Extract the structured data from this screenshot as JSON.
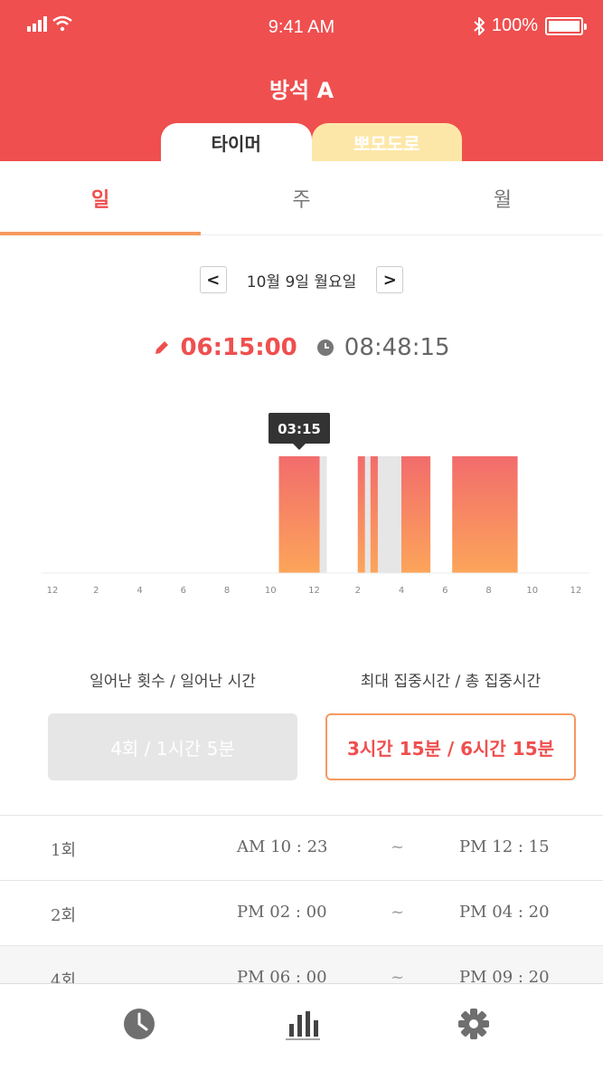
{
  "status_bar": {
    "time": "9:41 AM",
    "battery": "100%"
  },
  "app_title": "방석 A",
  "mode_tabs": {
    "timer": "타이머",
    "pomodoro": "뽀모도로"
  },
  "period_tabs": [
    "일",
    "주",
    "월"
  ],
  "date_nav": {
    "date": "10월 9일 월요일",
    "prev": "<",
    "next": ">"
  },
  "times": {
    "focus": "06:15:00",
    "total": "08:48:15"
  },
  "chart_data": {
    "type": "bar",
    "x_ticks": [
      "12",
      "2",
      "4",
      "6",
      "8",
      "10",
      "12",
      "2",
      "4",
      "6",
      "8",
      "10",
      "12"
    ],
    "x_range_hours": [
      0,
      24
    ],
    "focus_segments": [
      {
        "start": 10.383,
        "end": 12.25
      },
      {
        "start": 14.0,
        "end": 14.33
      },
      {
        "start": 14.58,
        "end": 14.92
      },
      {
        "start": 16.0,
        "end": 17.33
      },
      {
        "start": 18.33,
        "end": 21.33
      }
    ],
    "away_segments": [
      {
        "start": 12.25,
        "end": 12.58
      },
      {
        "start": 14.33,
        "end": 14.58
      },
      {
        "start": 14.92,
        "end": 16.0
      }
    ],
    "tooltip": {
      "label": "03:15",
      "segment_index": 0
    },
    "colors": {
      "bar_top": "#f26c6c",
      "bar_bottom": "#fca55a",
      "away": "#e6e6e6"
    }
  },
  "stats": {
    "left_label": "일어난 횟수 / 일어난 시간",
    "right_label": "최대 집중시간 / 총 집중시간",
    "left_value": "4회  /  1시간 5분",
    "right_value": "3시간 15분 / 6시간 15분"
  },
  "records": [
    {
      "idx": "1회",
      "start": "AM 10 : 23",
      "sep": "~",
      "end": "PM 12 : 15"
    },
    {
      "idx": "2회",
      "start": "PM 02 : 00",
      "sep": "~",
      "end": "PM 04 : 20"
    },
    {
      "idx": "4회",
      "start": "PM 06 : 00",
      "sep": "~",
      "end": "PM 09 : 20"
    }
  ],
  "bottom_nav": [
    "clock-icon",
    "stats-icon",
    "settings-icon"
  ],
  "colors": {
    "accent": "#ef4f4f",
    "accent_orange": "#f59a60",
    "pomo_tab": "#fde7a8"
  }
}
